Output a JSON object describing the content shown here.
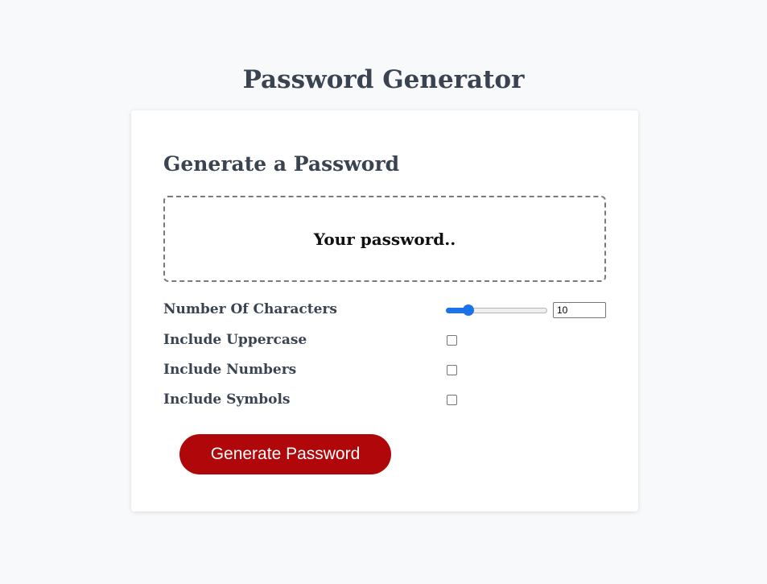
{
  "header": {
    "title": "Password Generator"
  },
  "card": {
    "heading": "Generate a Password",
    "password_placeholder": "Your password.."
  },
  "options": {
    "length": {
      "label": "Number Of Characters",
      "value": "10",
      "slider_fraction": 0.22
    },
    "uppercase": {
      "label": "Include Uppercase",
      "checked": false
    },
    "numbers": {
      "label": "Include Numbers",
      "checked": false
    },
    "symbols": {
      "label": "Include Symbols",
      "checked": false
    }
  },
  "actions": {
    "generate_label": "Generate Password"
  },
  "colors": {
    "accent": "#1a73e8",
    "button": "#b0070b",
    "text": "#3a4350",
    "background": "#f8f9fb"
  }
}
